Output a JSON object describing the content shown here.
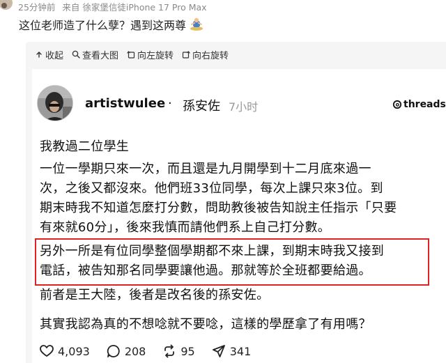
{
  "weibo": {
    "time": "25分钟前",
    "source": "来自 徐家堡信徒iPhone 17 Pro Max",
    "caption": "这位老师造了什么孽？遇到这两尊"
  },
  "toolbar": {
    "collapse": "收起",
    "view_large": "查看大图",
    "rotate_left": "向左旋转",
    "rotate_right": "向右旋转"
  },
  "post": {
    "username": "artistwulee",
    "separator": "·",
    "realname": "孫安佐",
    "time": "7小时",
    "brand": "threads",
    "lines": [
      "我教過二位學生",
      "一位一學期只來一次，而且還是九月開學到十二月底來過一",
      "次，之後又都沒來。他們班33位同學，每次上課只來3位。到",
      "期末時我不知道怎麼打分數，問助教後被告知說主任指示「只要",
      "有來就60分」，後來我慎而請他們系上自己打分數。",
      "另外一所是有位同學整個學期都不來上課，到期末時我又接到",
      "電話，被告知那名同學要讓他過。那就等於全班都要給過。",
      "前者是王大陸，後者是改名後的孫安佐。",
      "其實我認為真的不想唸就不要唸，這樣的學歷拿了有用嗎？"
    ]
  },
  "stats": {
    "likes": "4,093",
    "comments": "208",
    "reposts": "95",
    "shares": "341"
  },
  "colors": {
    "highlight_border": "#e02020",
    "toolbar_bg": "#f5f5f5",
    "meta_gray": "#8a8a8a"
  }
}
